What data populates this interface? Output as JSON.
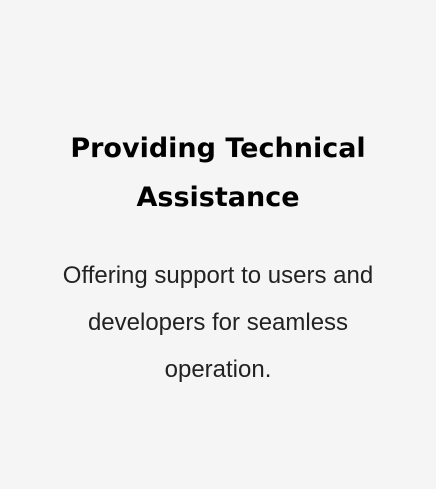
{
  "card": {
    "title": "Providing Technical Assistance",
    "description": "Offering support to users and developers for seamless operation."
  }
}
